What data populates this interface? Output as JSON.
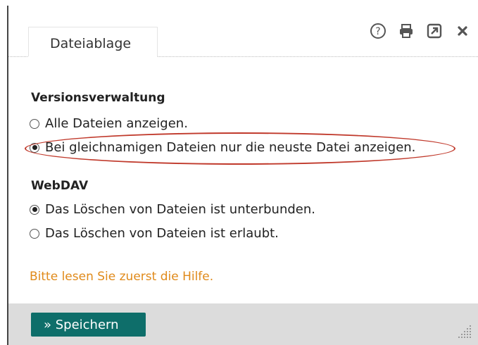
{
  "dialog": {
    "tab_label": "Dateiablage",
    "toolbar": {
      "help_icon": "question-circle-icon",
      "print_icon": "printer-icon",
      "open_external_icon": "external-link-icon",
      "close_icon": "close-icon"
    }
  },
  "versioning": {
    "title": "Versionsverwaltung",
    "options": [
      {
        "label": "Alle Dateien anzeigen.",
        "selected": false
      },
      {
        "label": "Bei gleichnamigen Dateien nur die neuste Datei anzeigen.",
        "selected": true
      }
    ]
  },
  "webdav": {
    "title": "WebDAV",
    "options": [
      {
        "label": "Das Löschen von Dateien ist unterbunden.",
        "selected": true
      },
      {
        "label": "Das Löschen von Dateien ist erlaubt.",
        "selected": false
      }
    ]
  },
  "hint_text": "Bitte lesen Sie zuerst die Hilfe.",
  "footer": {
    "save_label": "» Speichern"
  },
  "colors": {
    "accent": "#0e6e6a",
    "hint": "#e08a1a",
    "highlight_ring": "#c0392b",
    "footer_bg": "#dcdcdc"
  }
}
